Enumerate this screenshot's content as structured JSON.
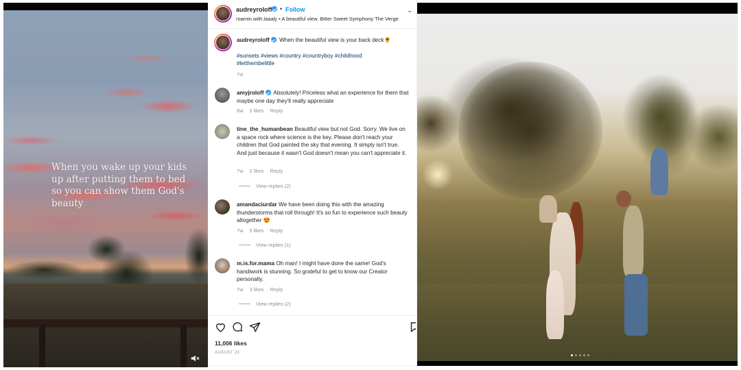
{
  "left_video": {
    "overlay_text": "When you wake up your kids up after putting them to bed so you can show them God's beauty",
    "mute_icon": "speaker-muted-icon"
  },
  "post": {
    "header": {
      "username": "audreyroloff",
      "verified": true,
      "separator": "•",
      "follow_label": "Follow",
      "subtitle": "roamin.with.laaaly • A beautiful view. Bitter Sweet Symphony The Verge",
      "more_label": "··"
    },
    "caption": {
      "username": "audreyroloff",
      "verified": true,
      "text": "When the beautiful view is your back deck",
      "emoji": "🌻",
      "hashtags": "#sunsets #views #country #countryboy #childhood #letthembelittle",
      "time": "7w"
    },
    "comments": [
      {
        "username": "amyjroloff",
        "verified": true,
        "text": "Absolutely! Priceless what an experience for them that maybe one day they'll really appreciate",
        "time": "6w",
        "likes": "2 likes",
        "reply": "Reply",
        "view_replies": null
      },
      {
        "username": "tine_the_humanbean",
        "verified": false,
        "text": "Beautiful view but not God. Sorry. We live on a space rock where science is the key. Please don't reach your children that God painted the sky that evening. It simply isn't true. And just because it wasn't God doesn't mean you can't appreciate it.",
        "time": "7w",
        "likes": "2 likes",
        "reply": "Reply",
        "view_replies": "View replies (2)"
      },
      {
        "username": "amandaciurdar",
        "verified": false,
        "text": "We have been doing this with the amazing thunderstorms that roll through! It's so fun to experience such beauty altogether 😍",
        "time": "7w",
        "likes": "5 likes",
        "reply": "Reply",
        "view_replies": "View replies (1)"
      },
      {
        "username": "m.is.for.mama",
        "verified": false,
        "text": "Oh man! I might have done the same! God's handiwork is stunning. So grateful to get to know our Creator personally.",
        "time": "7w",
        "likes": "3 likes",
        "reply": "Reply",
        "view_replies": "View replies (2)"
      }
    ],
    "actions": {
      "like_icon": "heart-icon",
      "comment_icon": "comment-icon",
      "share_icon": "send-icon",
      "save_icon": "bookmark-icon"
    },
    "likes": "11,006 likes",
    "date": "AUGUST 23"
  },
  "right_photo": {
    "carousel": {
      "total": 5,
      "active_index": 1
    }
  },
  "colors": {
    "follow_blue": "#0095f6",
    "verified_blue": "#3897f0",
    "hashtag": "#00376b",
    "secondary_text": "#8e8e8e"
  }
}
